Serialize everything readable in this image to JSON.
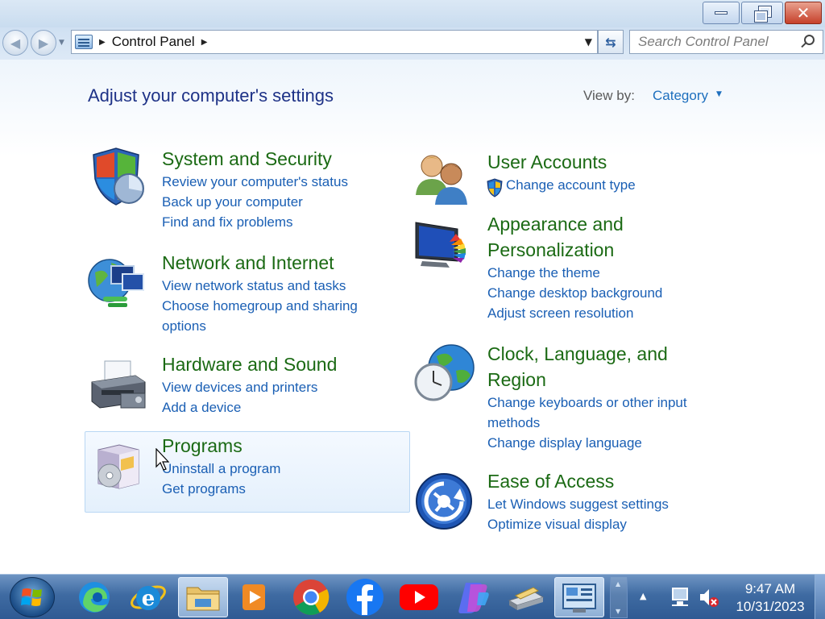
{
  "window": {
    "address_crumb": "Control Panel",
    "search_placeholder": "Search Control Panel"
  },
  "header": {
    "title": "Adjust your computer's settings",
    "view_by_label": "View by:",
    "view_by_value": "Category"
  },
  "categories": {
    "system": {
      "title": "System and Security",
      "links": [
        "Review your computer's status",
        "Back up your computer",
        "Find and fix problems"
      ]
    },
    "network": {
      "title": "Network and Internet",
      "links": [
        "View network status and tasks",
        "Choose homegroup and sharing options"
      ]
    },
    "hardware": {
      "title": "Hardware and Sound",
      "links": [
        "View devices and printers",
        "Add a device"
      ]
    },
    "programs": {
      "title": "Programs",
      "links": [
        "Uninstall a program",
        "Get programs"
      ]
    },
    "users": {
      "title": "User Accounts",
      "links": [
        "Change account type"
      ]
    },
    "appearance": {
      "title": "Appearance and Personalization",
      "links": [
        "Change the theme",
        "Change desktop background",
        "Adjust screen resolution"
      ]
    },
    "clock": {
      "title": "Clock, Language, and Region",
      "links": [
        "Change keyboards or other input methods",
        "Change display language"
      ]
    },
    "ease": {
      "title": "Ease of Access",
      "links": [
        "Let Windows suggest settings",
        "Optimize visual display"
      ]
    }
  },
  "taskbar": {
    "items": [
      "start-orb",
      "edge-icon",
      "internet-explorer-icon",
      "file-explorer-icon",
      "media-player-icon",
      "chrome-icon",
      "facebook-icon",
      "youtube-icon",
      "copilot-icon",
      "scanner-icon",
      "control-panel-icon"
    ],
    "clock_time": "9:47 AM",
    "clock_date": "10/31/2023"
  },
  "colors": {
    "category_title": "#1b6a14",
    "link": "#1a5fb4",
    "heading": "#1e3287",
    "taskbar": "#3f6ba2"
  }
}
